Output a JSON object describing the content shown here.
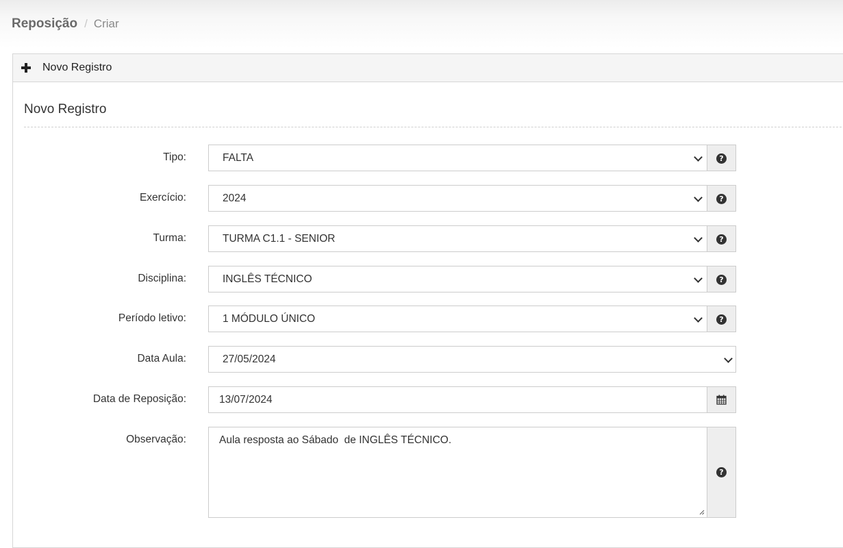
{
  "breadcrumb": {
    "title": "Reposição",
    "separator": "/",
    "current": "Criar"
  },
  "panel": {
    "heading": "Novo Registro",
    "section_title": "Novo Registro"
  },
  "form": {
    "tipo": {
      "label": "Tipo:",
      "value": "FALTA"
    },
    "exercicio": {
      "label": "Exercício:",
      "value": "2024"
    },
    "turma": {
      "label": "Turma:",
      "value": "TURMA C1.1 - SENIOR"
    },
    "disciplina": {
      "label": "Disciplina:",
      "value": "INGLÊS TÉCNICO"
    },
    "periodo": {
      "label": "Período letivo:",
      "value": "1 MÓDULO ÚNICO"
    },
    "data_aula": {
      "label": "Data Aula:",
      "value": "27/05/2024"
    },
    "data_reposicao": {
      "label": "Data de Reposição:",
      "value": "13/07/2024"
    },
    "observacao": {
      "label": "Observação:",
      "value": "Aula resposta ao Sábado  de INGLÊS TÉCNICO."
    }
  },
  "icons": {
    "help": "?",
    "plus": "plus-icon",
    "calendar": "calendar-icon",
    "chevron": "chevron-down-icon"
  },
  "colors": {
    "border": "#cccccc",
    "addon_bg": "#eeeeee",
    "panel_heading_bg": "#f5f5f5",
    "text": "#333333"
  }
}
